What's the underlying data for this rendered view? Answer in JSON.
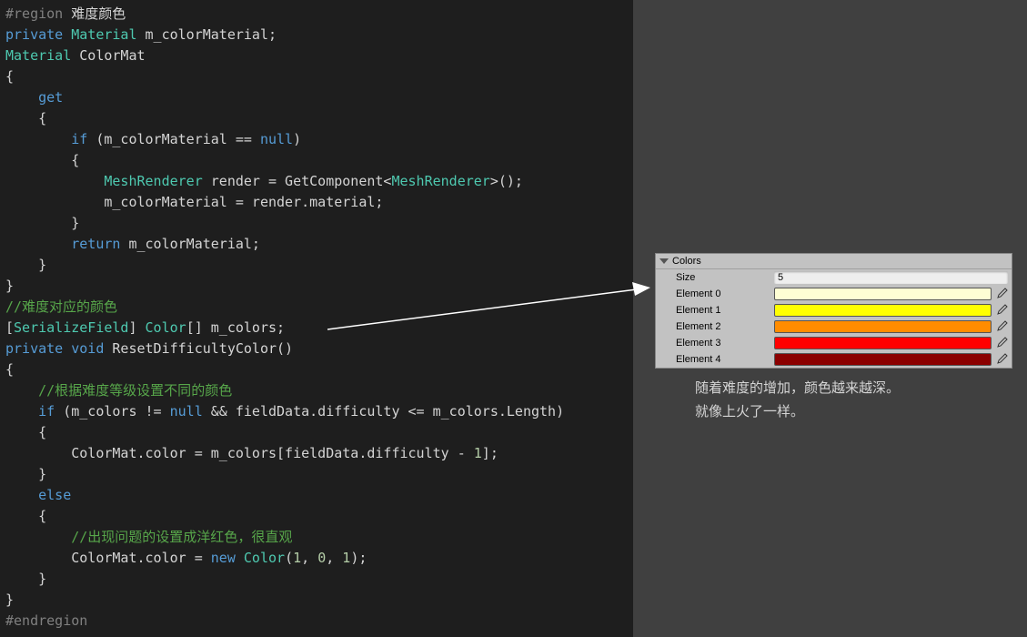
{
  "code": {
    "l1": {
      "pre": "#region ",
      "txt": "难度颜色"
    },
    "l2": {
      "kw1": "private",
      "ty": "Material",
      "name": "m_colorMaterial;"
    },
    "l3": {
      "ty": "Material",
      "name": "ColorMat"
    },
    "l4": {
      "br": "{"
    },
    "l5": {
      "pad": "    ",
      "kw": "get"
    },
    "l6": {
      "pad": "    ",
      "br": "{"
    },
    "l7": {
      "pad": "        ",
      "kw": "if",
      "txt": "(m_colorMaterial == ",
      "kw2": "null",
      "end": ")"
    },
    "l8": {
      "pad": "        ",
      "br": "{"
    },
    "l9": {
      "pad": "            ",
      "ty1": "MeshRenderer",
      "mid": " render = GetComponent<",
      "ty2": "MeshRenderer",
      "end": ">();"
    },
    "l10": {
      "pad": "            ",
      "txt": "m_colorMaterial = render.material;"
    },
    "l11": {
      "pad": "        ",
      "br": "}"
    },
    "l12": {
      "pad": "        ",
      "kw": "return",
      "txt": " m_colorMaterial;"
    },
    "l13": {
      "pad": "    ",
      "br": "}"
    },
    "l14": {
      "br": "}"
    },
    "l15": {
      "cm": "//难度对应的颜色"
    },
    "l16": {
      "br1": "[",
      "ty1": "SerializeField",
      "br2": "] ",
      "ty2": "Color",
      "arr": "[] m_colors;"
    },
    "l17": {
      "kw1": "private",
      "kw2": "void",
      "name": "ResetDifficultyColor()"
    },
    "l18": {
      "br": "{"
    },
    "l19": {
      "pad": "    ",
      "cm": "//根据难度等级设置不同的颜色"
    },
    "l20": {
      "pad": "    ",
      "kw": "if",
      "txt": " (m_colors != ",
      "kw2": "null",
      "mid": " && fieldData.difficulty <= m_colors.Length)"
    },
    "l21": {
      "pad": "    ",
      "br": "{"
    },
    "l22": {
      "pad": "        ",
      "txt1": "ColorMat.color = m_colors[fieldData.difficulty - ",
      "num": "1",
      "txt2": "];"
    },
    "l23": {
      "pad": "    ",
      "br": "}"
    },
    "l24": {
      "pad": "    ",
      "kw": "else"
    },
    "l25": {
      "pad": "    ",
      "br": "{"
    },
    "l26": {
      "pad": "        ",
      "cm": "//出现问题的设置成洋红色，很直观"
    },
    "l27": {
      "pad": "        ",
      "txt1": "ColorMat.color = ",
      "kw": "new",
      "sp": " ",
      "ty": "Color",
      "txt2": "(",
      "n1": "1",
      "c1": ", ",
      "n2": "0",
      "c2": ", ",
      "n3": "1",
      "txt3": ");"
    },
    "l28": {
      "pad": "    ",
      "br": "}"
    },
    "l29": {
      "br": "}"
    },
    "l30": {
      "pre": "#endregion"
    }
  },
  "inspector": {
    "header": "Colors",
    "size_label": "Size",
    "size_value": "5",
    "elements": [
      {
        "label": "Element 0",
        "color": "#fefed4"
      },
      {
        "label": "Element 1",
        "color": "#ffff00"
      },
      {
        "label": "Element 2",
        "color": "#ff8c00"
      },
      {
        "label": "Element 3",
        "color": "#ff0000"
      },
      {
        "label": "Element 4",
        "color": "#8b0000"
      }
    ]
  },
  "annotation": {
    "line1": "随着难度的增加，颜色越来越深。",
    "line2": "就像上火了一样。"
  }
}
